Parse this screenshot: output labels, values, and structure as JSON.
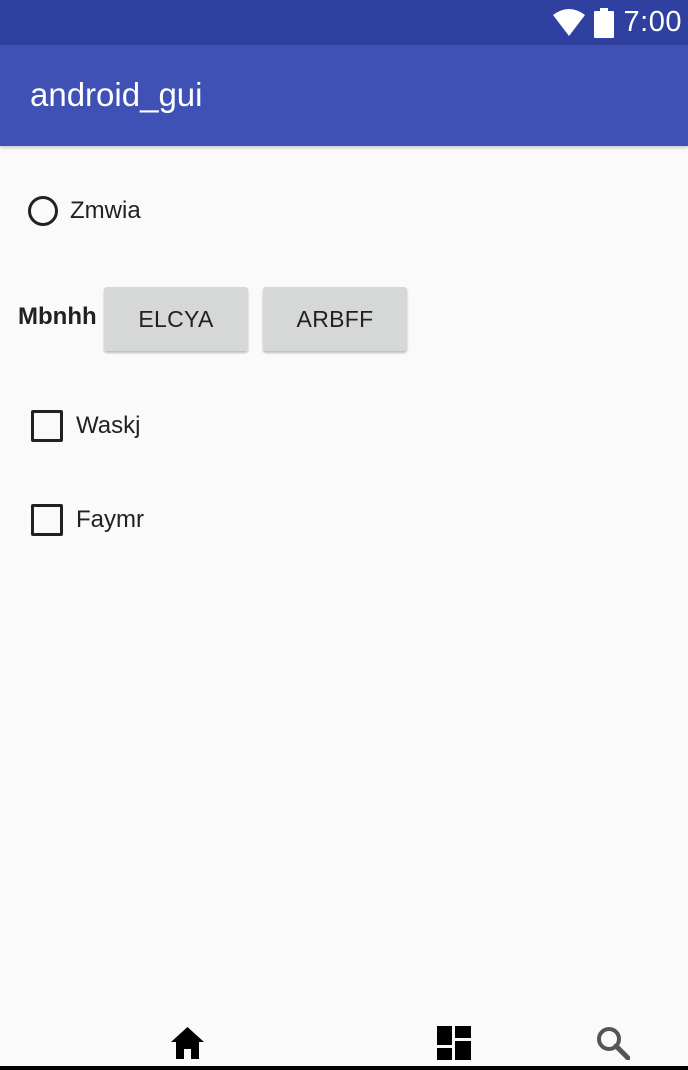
{
  "status_bar": {
    "time": "7:00",
    "icons": [
      "wifi-icon",
      "battery-icon"
    ]
  },
  "app_bar": {
    "title": "android_gui",
    "color": "#3f51b5"
  },
  "content": {
    "radio": {
      "label": "Zmwia",
      "checked": false
    },
    "button_row": {
      "label": "Mbnhh",
      "buttons": [
        {
          "label": "ELCYA"
        },
        {
          "label": "ARBFF"
        }
      ]
    },
    "checkboxes": [
      {
        "label": "Waskj",
        "checked": false
      },
      {
        "label": "Faymr",
        "checked": false
      }
    ]
  },
  "bottom_nav": {
    "items": [
      "home-icon",
      "dashboard-icon",
      "search-icon"
    ]
  }
}
